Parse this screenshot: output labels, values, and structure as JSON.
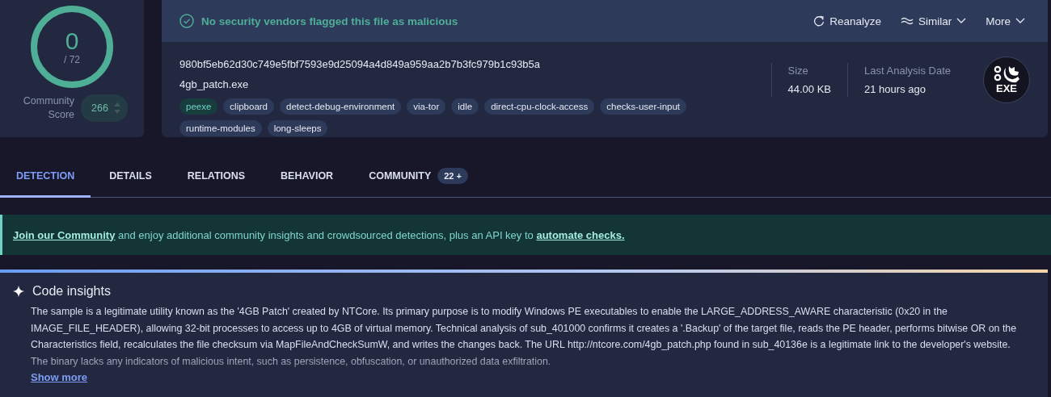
{
  "score": {
    "detections": "0",
    "total": "/ 72",
    "community_label": "Community Score",
    "community_value": "266"
  },
  "status": {
    "message": "No security vendors flagged this file as malicious"
  },
  "actions": [
    {
      "kind": "reanalyze",
      "label": "Reanalyze"
    },
    {
      "kind": "similar",
      "label": "Similar"
    },
    {
      "kind": "more",
      "label": "More"
    }
  ],
  "file": {
    "hash": "980bf5eb62d30c749e5fbf7593e9d25094a4d849a959aa2b7b3fc979b1c93b5a",
    "name": "4gb_patch.exe",
    "type_label": "EXE"
  },
  "tags": [
    {
      "label": "peexe",
      "kind": "filetype"
    },
    {
      "label": "clipboard",
      "kind": "tag"
    },
    {
      "label": "detect-debug-environment",
      "kind": "tag"
    },
    {
      "label": "via-tor",
      "kind": "tag"
    },
    {
      "label": "idle",
      "kind": "tag"
    },
    {
      "label": "direct-cpu-clock-access",
      "kind": "tag"
    },
    {
      "label": "checks-user-input",
      "kind": "tag"
    },
    {
      "label": "runtime-modules",
      "kind": "tag"
    },
    {
      "label": "long-sleeps",
      "kind": "tag"
    }
  ],
  "meta": [
    {
      "label": "Size",
      "value": "44.00 KB"
    },
    {
      "label": "Last Analysis Date",
      "value": "21 hours ago"
    }
  ],
  "tabs": [
    {
      "label": "DETECTION",
      "selected": true
    },
    {
      "label": "DETAILS",
      "selected": false
    },
    {
      "label": "RELATIONS",
      "selected": false
    },
    {
      "label": "BEHAVIOR",
      "selected": false
    },
    {
      "label": "COMMUNITY",
      "selected": false,
      "badge": "22 +"
    }
  ],
  "banner": {
    "parts": [
      {
        "kind": "link",
        "text": "Join our Community"
      },
      {
        "kind": "text",
        "text": " and enjoy additional community insights and crowdsourced detections, plus an API key to "
      },
      {
        "kind": "link",
        "text": "automate checks."
      }
    ]
  },
  "insights": {
    "title": "Code insights",
    "body": "The sample is a legitimate utility known as the '4GB Patch' created by NTCore. Its primary purpose is to modify Windows PE executables to enable the LARGE_ADDRESS_AWARE characteristic (0x20 in the IMAGE_FILE_HEADER), allowing 32-bit processes to access up to 4GB of virtual memory. Technical analysis of sub_401000 confirms it creates a '.Backup' of the target file, reads the PE header, performs bitwise OR on the Characteristics field, recalculates the file checksum via MapFileAndCheckSumW, and writes the changes back. The URL http://ntcore.com/4gb_patch.php found in sub_40136e is a legitimate link to the developer's website. The binary lacks any indicators of malicious intent, such as persistence, obfuscation, or unauthorized data exfiltration.",
    "more": "Show more"
  }
}
